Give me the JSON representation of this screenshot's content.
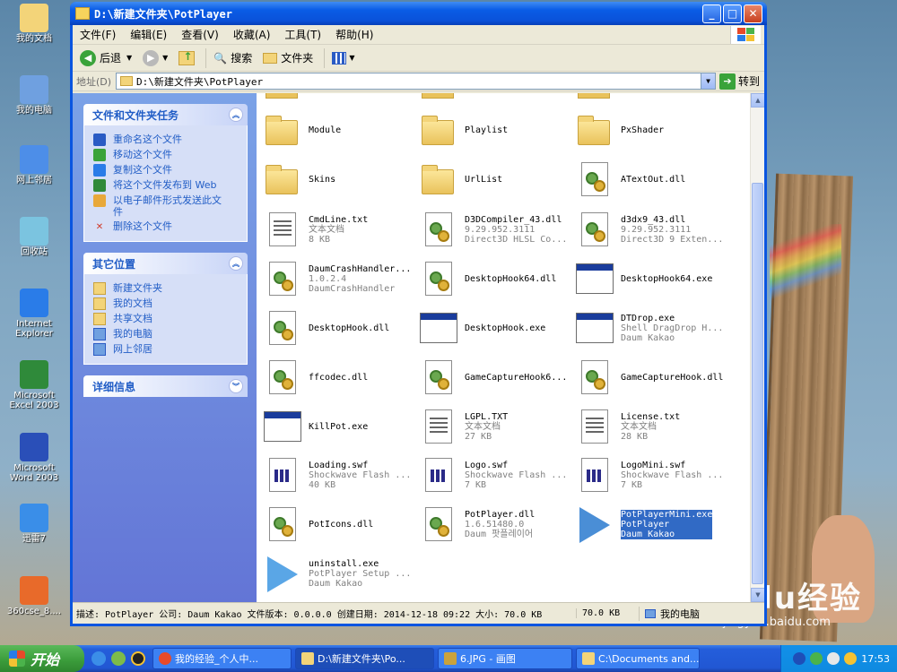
{
  "window": {
    "title": "D:\\新建文件夹\\PotPlayer",
    "colors": {
      "titlebar": "#0a55e0",
      "taskpane": "#6f8fe0",
      "selection": "#316ac5"
    }
  },
  "menu": [
    "文件(F)",
    "编辑(E)",
    "查看(V)",
    "收藏(A)",
    "工具(T)",
    "帮助(H)"
  ],
  "toolbar": {
    "back": "后退",
    "search": "搜索",
    "folders": "文件夹"
  },
  "address": {
    "label": "地址(D)",
    "value": "D:\\新建文件夹\\PotPlayer",
    "go": "转到"
  },
  "tasks": {
    "file_tasks": {
      "title": "文件和文件夹任务",
      "items": [
        "重命名这个文件",
        "移动这个文件",
        "复制这个文件",
        "将这个文件发布到 Web",
        "以电子邮件形式发送此文件",
        "删除这个文件"
      ]
    },
    "other_places": {
      "title": "其它位置",
      "items": [
        "新建文件夹",
        "我的文档",
        "共享文档",
        "我的电脑",
        "网上邻居"
      ]
    },
    "details": {
      "title": "详细信息"
    }
  },
  "files": [
    {
      "name": "Module",
      "type": "folder",
      "l2": "",
      "l3": ""
    },
    {
      "name": "Playlist",
      "type": "folder",
      "l2": "",
      "l3": ""
    },
    {
      "name": "PxShader",
      "type": "folder",
      "l2": "",
      "l3": ""
    },
    {
      "name": "Skins",
      "type": "folder",
      "l2": "",
      "l3": ""
    },
    {
      "name": "UrlList",
      "type": "folder",
      "l2": "",
      "l3": ""
    },
    {
      "name": "ATextOut.dll",
      "type": "dll",
      "l2": "",
      "l3": ""
    },
    {
      "name": "CmdLine.txt",
      "type": "doc",
      "l2": "文本文档",
      "l3": "8 KB"
    },
    {
      "name": "D3DCompiler_43.dll",
      "type": "dll",
      "l2": "9.29.952.3111",
      "l3": "Direct3D HLSL Co..."
    },
    {
      "name": "d3dx9_43.dll",
      "type": "dll",
      "l2": "9.29.952.3111",
      "l3": "Direct3D 9 Exten..."
    },
    {
      "name": "DaumCrashHandler...",
      "type": "dll",
      "l2": "1.0.2.4",
      "l3": "DaumCrashHandler"
    },
    {
      "name": "DesktopHook64.dll",
      "type": "dll",
      "l2": "",
      "l3": ""
    },
    {
      "name": "DesktopHook64.exe",
      "type": "exe",
      "l2": "",
      "l3": ""
    },
    {
      "name": "DesktopHook.dll",
      "type": "dll",
      "l2": "",
      "l3": ""
    },
    {
      "name": "DesktopHook.exe",
      "type": "exe",
      "l2": "",
      "l3": ""
    },
    {
      "name": "DTDrop.exe",
      "type": "exe",
      "l2": "Shell DragDrop H...",
      "l3": "Daum Kakao"
    },
    {
      "name": "ffcodec.dll",
      "type": "dll",
      "l2": "",
      "l3": ""
    },
    {
      "name": "GameCaptureHook6...",
      "type": "dll",
      "l2": "",
      "l3": ""
    },
    {
      "name": "GameCaptureHook.dll",
      "type": "dll",
      "l2": "",
      "l3": ""
    },
    {
      "name": "KillPot.exe",
      "type": "exe",
      "l2": "",
      "l3": ""
    },
    {
      "name": "LGPL.TXT",
      "type": "doc",
      "l2": "文本文档",
      "l3": "27 KB"
    },
    {
      "name": "License.txt",
      "type": "doc",
      "l2": "文本文档",
      "l3": "28 KB"
    },
    {
      "name": "Loading.swf",
      "type": "swf",
      "l2": "Shockwave Flash ...",
      "l3": "40 KB"
    },
    {
      "name": "Logo.swf",
      "type": "swf",
      "l2": "Shockwave Flash ...",
      "l3": "7 KB"
    },
    {
      "name": "LogoMini.swf",
      "type": "swf",
      "l2": "Shockwave Flash ...",
      "l3": "7 KB"
    },
    {
      "name": "PotIcons.dll",
      "type": "dll",
      "l2": "",
      "l3": ""
    },
    {
      "name": "PotPlayer.dll",
      "type": "dll",
      "l2": "1.6.51480.0",
      "l3": "Daum 팟플레이어"
    },
    {
      "name": "PotPlayerMini.exe",
      "type": "play",
      "l2": "PotPlayer",
      "l3": "Daum Kakao",
      "selected": true
    },
    {
      "name": "uninstall.exe",
      "type": "play-outline",
      "l2": "PotPlayer Setup ...",
      "l3": "Daum Kakao"
    }
  ],
  "status": {
    "description": "描述: PotPlayer 公司: Daum Kakao 文件版本: 0.0.0.0 创建日期: 2014-12-18 09:22 大小: 70.0 KB",
    "size": "70.0 KB",
    "location": "我的电脑"
  },
  "desktop_icons": [
    "我的文档",
    "我的电脑",
    "网上邻居",
    "回收站",
    "Internet Explorer",
    "Microsoft Excel 2003",
    "Microsoft Word 2003",
    "迅雷7",
    "360cse_8...."
  ],
  "taskbar": {
    "start": "开始",
    "tasks": [
      "我的经验_个人中...",
      "D:\\新建文件夹\\Po...",
      "6.JPG - 画图",
      "C:\\Documents and..."
    ],
    "clock": "17:53"
  },
  "watermark": {
    "brand": "Baidu经验",
    "url": "jingyan.baidu.com"
  }
}
